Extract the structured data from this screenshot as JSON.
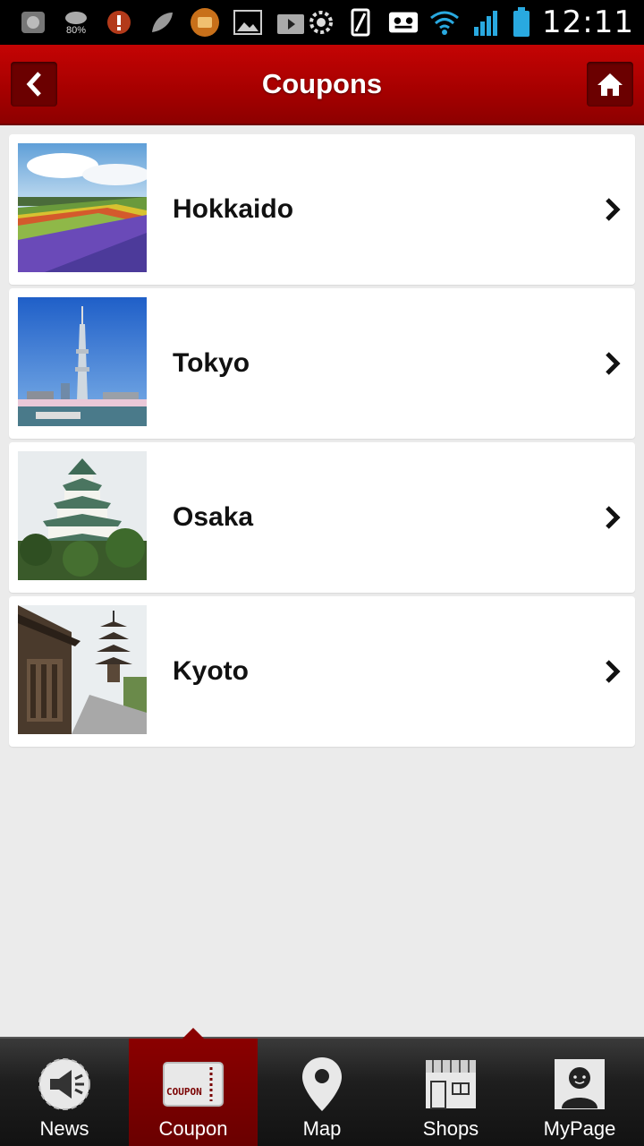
{
  "status_bar": {
    "time": "12:11",
    "weather_label": "80%",
    "left_icons": [
      "photo-app-icon",
      "weather-icon",
      "alert-icon",
      "leaf-icon",
      "folder-app-icon",
      "gallery-icon",
      "play-store-icon"
    ],
    "right_icons": [
      "settings-gear-icon",
      "rotation-icon",
      "voicemail-icon",
      "wifi-icon",
      "signal-icon",
      "battery-icon"
    ]
  },
  "header": {
    "title": "Coupons",
    "back_icon": "chevron-left-icon",
    "home_icon": "home-icon",
    "color": "#b00000"
  },
  "coupon_list": [
    {
      "label": "Hokkaido",
      "image": "lavender-fields-photo"
    },
    {
      "label": "Tokyo",
      "image": "tokyo-skytree-photo"
    },
    {
      "label": "Osaka",
      "image": "osaka-castle-photo"
    },
    {
      "label": "Kyoto",
      "image": "kyoto-pagoda-street-photo"
    }
  ],
  "tab_bar": {
    "active_tab": "Coupon",
    "tabs": [
      {
        "label": "News",
        "icon": "megaphone-icon"
      },
      {
        "label": "Coupon",
        "icon": "coupon-ticket-icon",
        "icon_text": "COUPON"
      },
      {
        "label": "Map",
        "icon": "map-pin-icon"
      },
      {
        "label": "Shops",
        "icon": "storefront-icon"
      },
      {
        "label": "MyPage",
        "icon": "user-profile-icon"
      }
    ]
  }
}
